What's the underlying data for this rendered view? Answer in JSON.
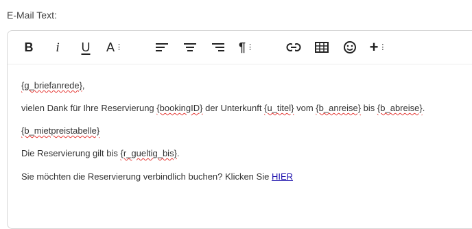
{
  "field": {
    "label": "E-Mail Text:"
  },
  "toolbar": {
    "bold": "B",
    "italic": "i",
    "underline": "U",
    "font_size": "A",
    "icons": [
      "align-left-icon",
      "align-center-icon",
      "align-right-icon",
      "paragraph-icon",
      "link-icon",
      "table-icon",
      "emoji-icon",
      "insert-plus-icon"
    ]
  },
  "content": {
    "line1": {
      "placeholder": "{g_briefanrede}",
      "suffix": ","
    },
    "line2": {
      "t1": "vielen Dank für Ihre Reservierung ",
      "p1": "{bookingID}",
      "t2": " der Unterkunft ",
      "p2": "{u_titel}",
      "t3": " vom ",
      "p3": "{b_anreise}",
      "t4": " bis ",
      "p4": "{b_abreise}",
      "t5": "."
    },
    "line3": {
      "placeholder": "{b_mietpreistabelle}"
    },
    "line4": {
      "t1": "Die Reservierung gilt bis ",
      "p1": "{r_gueltig_bis}",
      "t2": "."
    },
    "line5": {
      "t1": "Sie möchten die Reservierung verbindlich buchen? Klicken Sie ",
      "link": "HIER"
    }
  }
}
